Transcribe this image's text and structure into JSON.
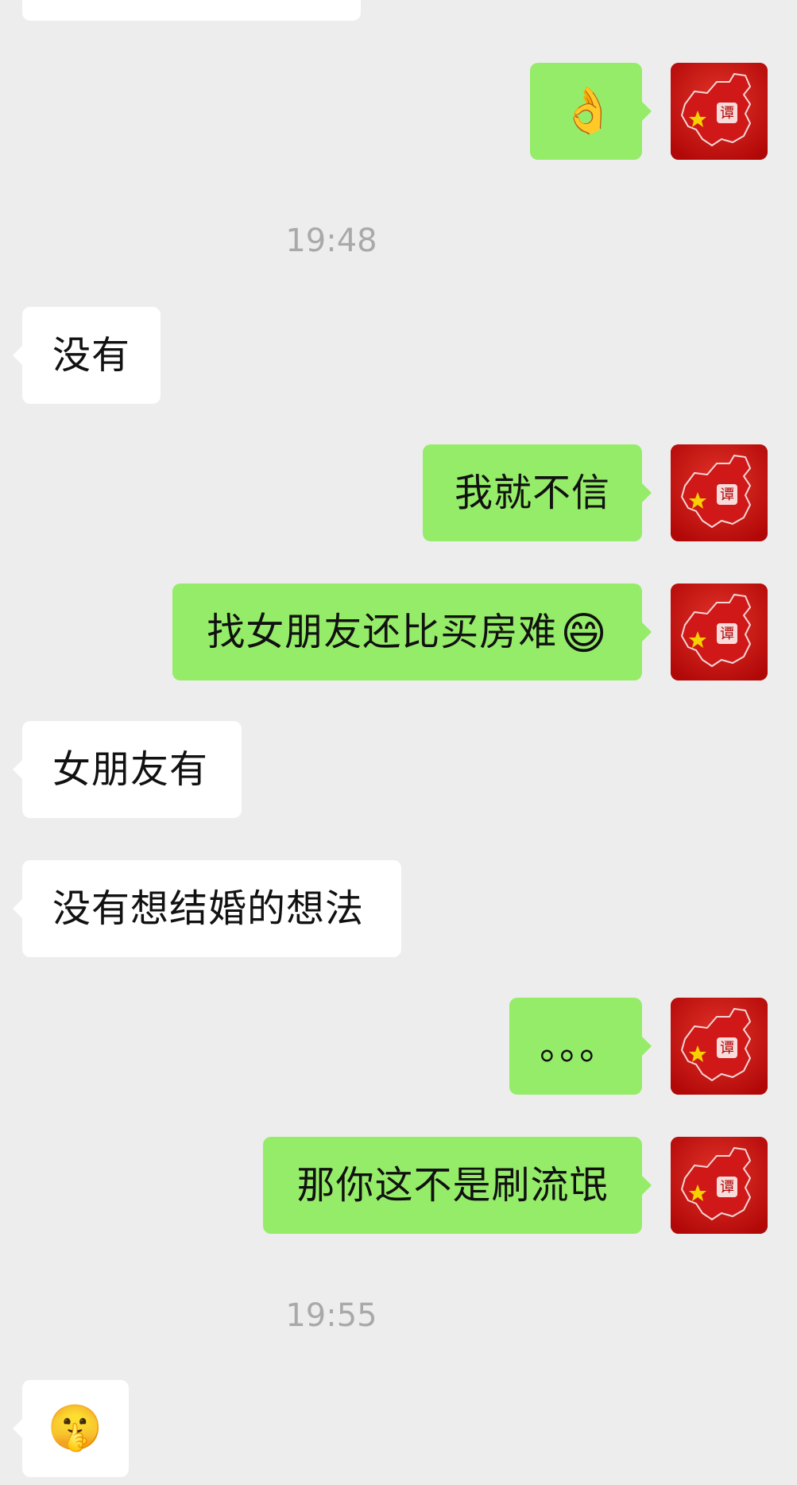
{
  "colors": {
    "background": "#ededed",
    "incoming_bubble": "#ffffff",
    "outgoing_bubble": "#95ec69",
    "timestamp_text": "#a9a9a9",
    "avatar_red": "#c90d0d"
  },
  "timestamps": {
    "first": "19:48",
    "second": "19:55"
  },
  "messages": [
    {
      "direction": "outgoing",
      "content": "👌"
    },
    {
      "direction": "incoming",
      "content": "没有"
    },
    {
      "direction": "outgoing",
      "content": "我就不信"
    },
    {
      "direction": "outgoing",
      "content": "找女朋友还比买房难",
      "emoji": "😄"
    },
    {
      "direction": "incoming",
      "content": "女朋友有"
    },
    {
      "direction": "incoming",
      "content": "没有想结婚的想法"
    },
    {
      "direction": "outgoing",
      "content": "。。。"
    },
    {
      "direction": "outgoing",
      "content": "那你这不是刷流氓"
    },
    {
      "direction": "incoming",
      "content": "🤫"
    }
  ],
  "avatar": {
    "icon": "china-map-flag-icon",
    "badge_text": "谭"
  }
}
